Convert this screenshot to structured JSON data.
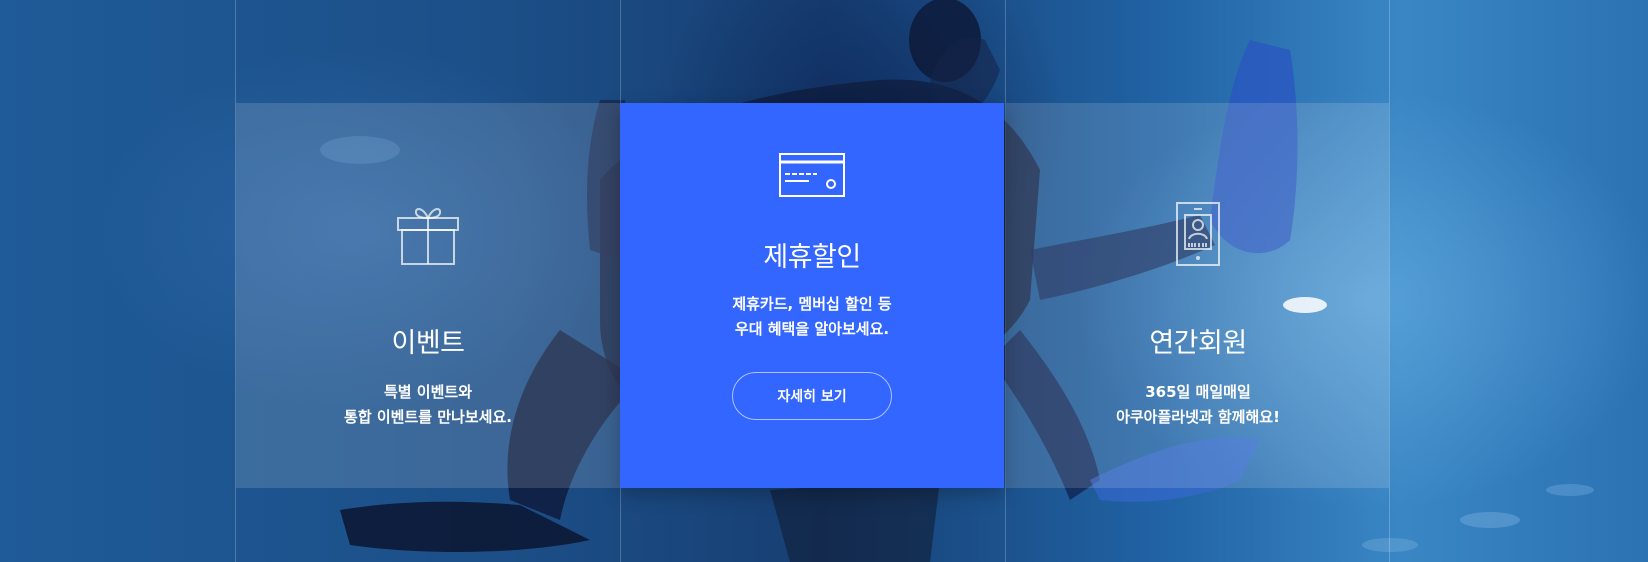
{
  "colors": {
    "featured_bg": "#3366ff",
    "text": "#ffffff"
  },
  "cards": [
    {
      "icon": "gift-icon",
      "title": "이벤트",
      "desc_line1": "특별 이벤트와",
      "desc_line2": "통합 이벤트를 만나보세요."
    },
    {
      "icon": "credit-card-icon",
      "title": "제휴할인",
      "desc_line1": "제휴카드, 멤버십 할인 등",
      "desc_line2": "우대 혜택을 알아보세요.",
      "button_label": "자세히 보기"
    },
    {
      "icon": "membership-card-icon",
      "title": "연간회원",
      "desc_line1": "365일 매일매일",
      "desc_line2": "아쿠아플라넷과 함께해요!"
    }
  ]
}
